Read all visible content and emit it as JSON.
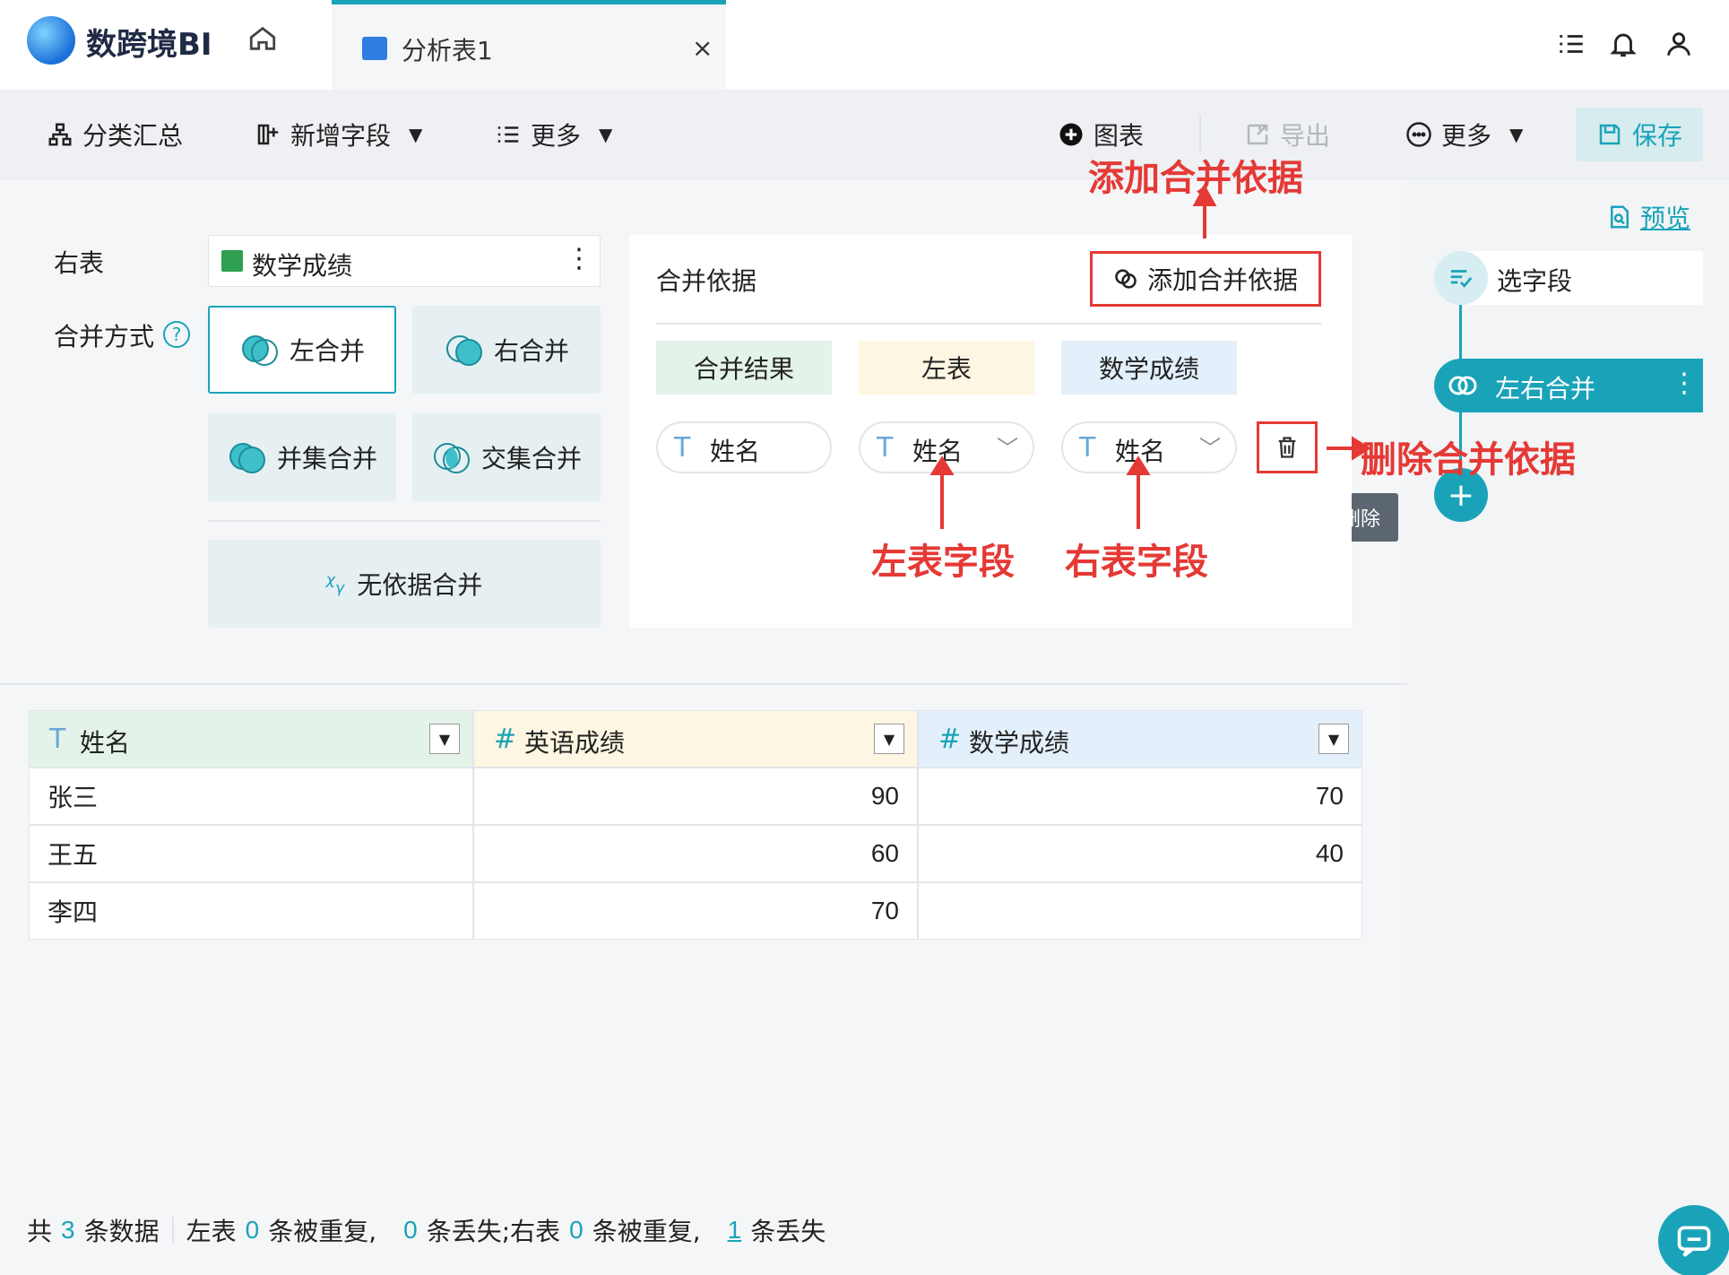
{
  "app": {
    "logo_text": "数跨境BI",
    "tab_label": "分析表1",
    "tab_close": "×"
  },
  "toolbar": {
    "category_summary": "分类汇总",
    "add_field": "新增字段",
    "more_left": "更多",
    "chart": "图表",
    "export": "导出",
    "more_right": "更多",
    "save": "保存"
  },
  "config": {
    "right_table_label": "右表",
    "right_table_value": "数学成绩",
    "merge_mode_label": "合并方式",
    "help_glyph": "?",
    "modes": {
      "left": "左合并",
      "right": "右合并",
      "union": "并集合并",
      "intersect": "交集合并",
      "none": "无依据合并"
    }
  },
  "basis": {
    "title": "合并依据",
    "add_button": "添加合并依据",
    "headers": {
      "result": "合并结果",
      "left": "左表",
      "right": "数学成绩"
    },
    "row": {
      "type_glyph": "T",
      "result": "姓名",
      "left": "姓名",
      "right": "姓名"
    },
    "delete_tooltip": "删除"
  },
  "annotations": {
    "add_basis": "添加合并依据",
    "delete_basis": "删除合并依据",
    "left_field": "左表字段",
    "right_field": "右表字段"
  },
  "side_panel": {
    "preview": "预览",
    "step_select": "选字段",
    "step_merge": "左右合并",
    "add_step": "+"
  },
  "table": {
    "columns": [
      {
        "type": "T",
        "label": "姓名"
      },
      {
        "type": "#",
        "label": "英语成绩"
      },
      {
        "type": "#",
        "label": "数学成绩"
      }
    ],
    "rows": [
      [
        "张三",
        "90",
        "70"
      ],
      [
        "王五",
        "60",
        "40"
      ],
      [
        "李四",
        "70",
        ""
      ]
    ]
  },
  "footer": {
    "prefix": "共",
    "total": "3",
    "total_suffix": "条数据",
    "left_prefix": "左表",
    "left_dup": "0",
    "dup_text": "条被重复,",
    "left_lost": "0",
    "left_lost_text": "条丢失;",
    "right_prefix": "右表",
    "right_dup": "0",
    "right_lost": "1",
    "right_lost_text": "条丢失"
  },
  "colors": {
    "accent": "#1aa3b8",
    "annotation": "#e53935"
  }
}
